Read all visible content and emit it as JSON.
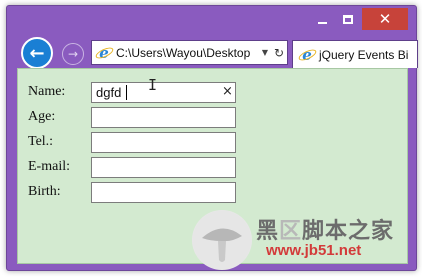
{
  "window": {
    "minimize_icon": "minimize-icon",
    "maximize_icon": "maximize-icon",
    "close_symbol": "✕"
  },
  "nav": {
    "back_symbol": "←",
    "forward_symbol": "→",
    "address": "C:\\Users\\Wayou\\Desktop",
    "dropdown_symbol": "▼",
    "refresh_symbol": "↻",
    "tab_title": "jQuery Events Bi"
  },
  "form": {
    "name_label": "Name:",
    "name_value": "dgfd",
    "clear_symbol": "×",
    "age_label": "Age:",
    "tel_label": "Tel.:",
    "email_label": "E-mail:",
    "birth_label": "Birth:",
    "cursor_symbol": "I"
  },
  "watermark": {
    "title_strong": "黑",
    "title_dim": "区",
    "title_rest": "脚本之家",
    "url": "www.jb51.net"
  },
  "colors": {
    "frame": "#8a5bbf",
    "content_bg": "#d3ead0",
    "close_btn": "#c7433a",
    "back_btn": "#1a7fd4",
    "watermark_url": "#d33a3a"
  }
}
